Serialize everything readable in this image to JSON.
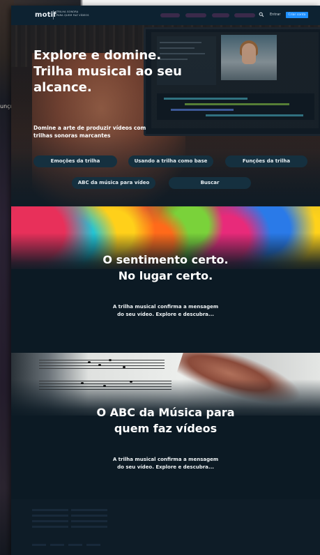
{
  "background": {
    "edge_text": "unçı"
  },
  "header": {
    "logo": "motif",
    "tagline": [
      "TRILHA SONORA",
      "PARA QUEM FAZ VÍDEOS"
    ],
    "login_label": "Entrar",
    "cta_label": "Criar conta"
  },
  "hero": {
    "title": "Explore e domine. Trilha musical ao seu alcance.",
    "subtitle": "Domine a arte de produzir vídeos com trilhas sonoras marcantes",
    "buttons": [
      "Emoções da trilha",
      "Usando a trilha como base",
      "Funções da trilha",
      "ABC da música para vídeo",
      "Buscar"
    ]
  },
  "section_feeling": {
    "title": "O sentimento certo. No lugar certo.",
    "body": "A trilha musical confirma a mensagem do seu vídeo. Explore e descubra..."
  },
  "section_abc": {
    "title": "O ABC da Música para quem faz vídeos",
    "body": "A trilha musical confirma a mensagem do seu vídeo. Explore e descubra..."
  },
  "colors": {
    "accent": "#1e90ff",
    "page_bg": "#0e1c27",
    "button_bg": "#15303f"
  }
}
